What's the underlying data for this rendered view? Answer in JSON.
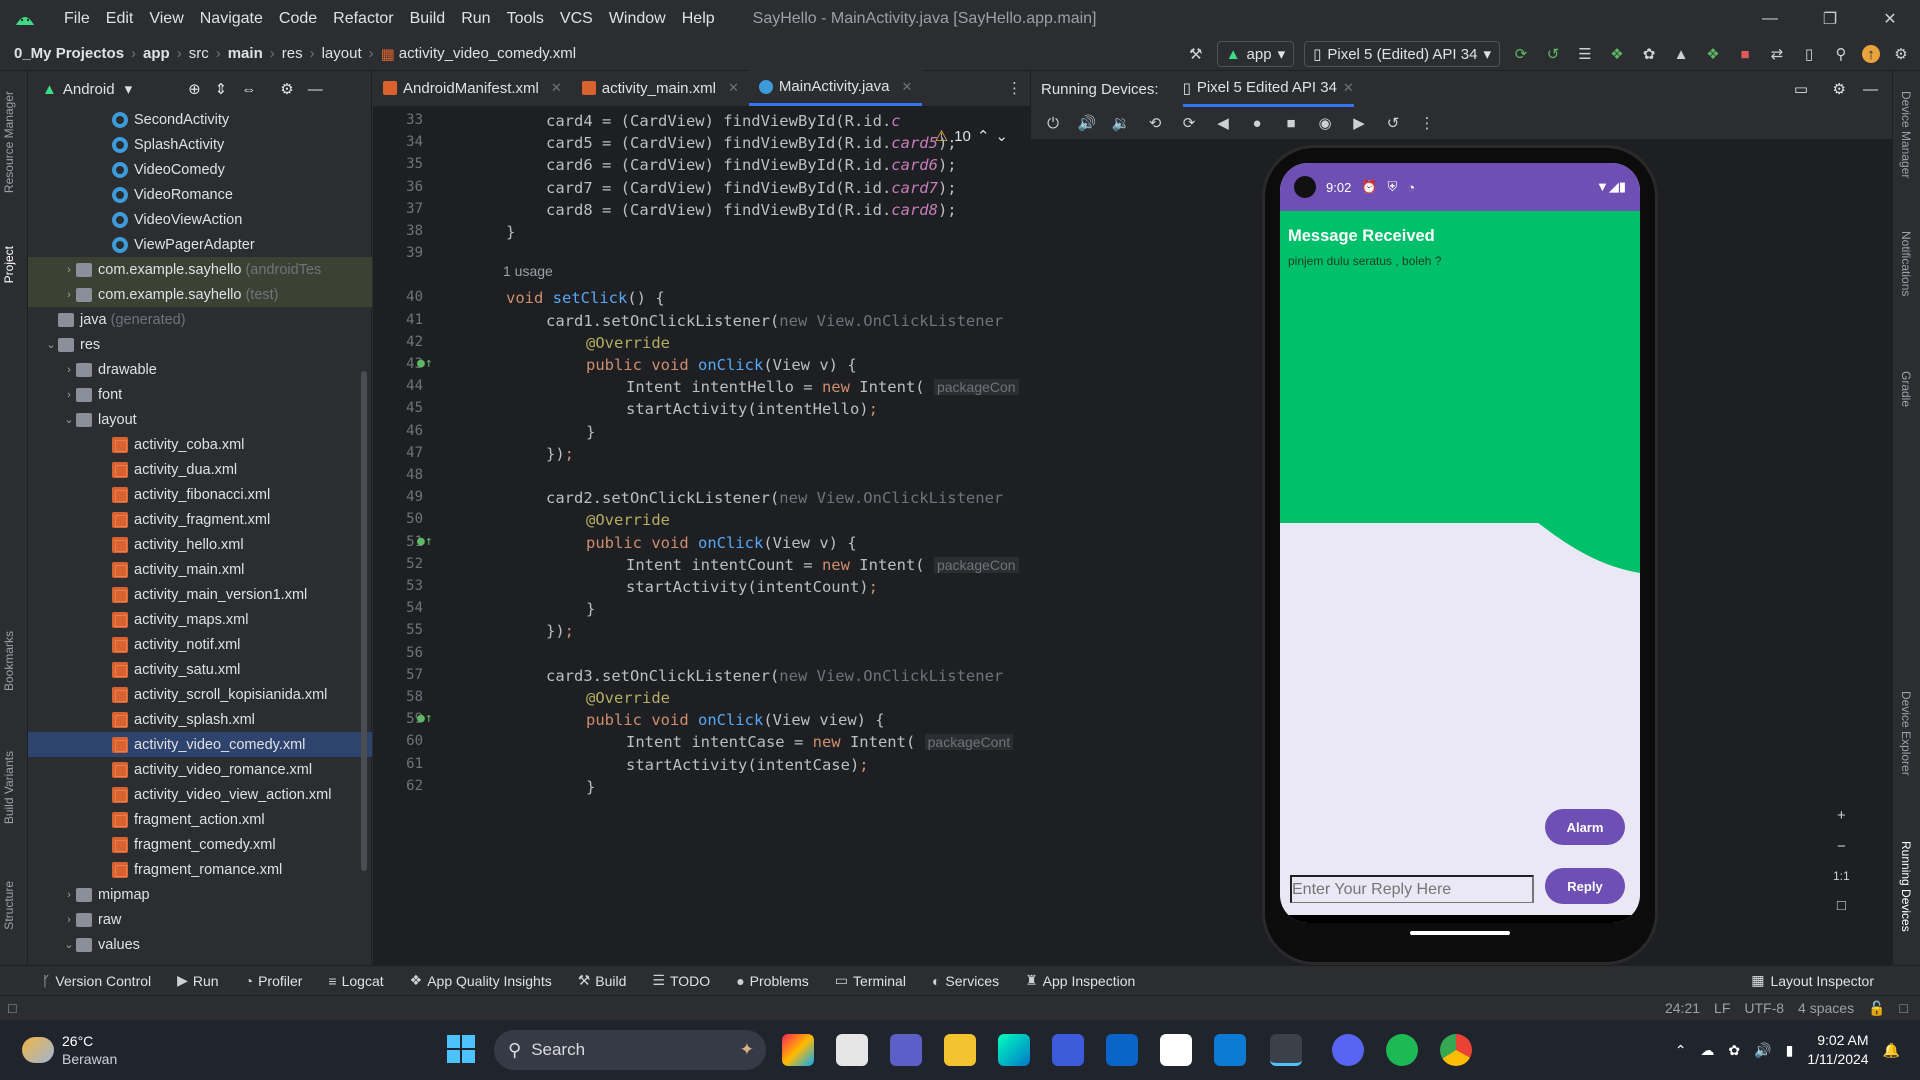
{
  "window": {
    "title": "SayHello - MainActivity.java [SayHello.app.main]",
    "menu": [
      "File",
      "Edit",
      "View",
      "Navigate",
      "Code",
      "Refactor",
      "Build",
      "Run",
      "Tools",
      "VCS",
      "Window",
      "Help"
    ]
  },
  "breadcrumb": [
    "0_My Projectos",
    "app",
    "src",
    "main",
    "res",
    "layout",
    "activity_video_comedy.xml"
  ],
  "toolbar": {
    "run_config": "app",
    "device": "Pixel 5 (Edited) API 34"
  },
  "project_panel": {
    "view_mode": "Android",
    "tree": [
      {
        "label": "SecondActivity",
        "type": "class",
        "indent": 5
      },
      {
        "label": "SplashActivity",
        "type": "class",
        "indent": 5
      },
      {
        "label": "VideoComedy",
        "type": "class",
        "indent": 5
      },
      {
        "label": "VideoRomance",
        "type": "class",
        "indent": 5
      },
      {
        "label": "VideoViewAction",
        "type": "class",
        "indent": 5
      },
      {
        "label": "ViewPagerAdapter",
        "type": "class",
        "indent": 5
      },
      {
        "label": "com.example.sayhello",
        "suffix": "(androidTes",
        "type": "pkg",
        "indent": 3,
        "arrow": "›",
        "bg": "grn"
      },
      {
        "label": "com.example.sayhello",
        "suffix": "(test)",
        "type": "pkg",
        "indent": 3,
        "arrow": "›",
        "bg": "grn"
      },
      {
        "label": "java",
        "suffix": "(generated)",
        "type": "folder",
        "indent": 2
      },
      {
        "label": "res",
        "type": "folder",
        "indent": 2,
        "arrow": "⌄"
      },
      {
        "label": "drawable",
        "type": "folder",
        "indent": 3,
        "arrow": "›"
      },
      {
        "label": "font",
        "type": "folder",
        "indent": 3,
        "arrow": "›"
      },
      {
        "label": "layout",
        "type": "folder",
        "indent": 3,
        "arrow": "⌄"
      },
      {
        "label": "activity_coba.xml",
        "type": "xml",
        "indent": 5
      },
      {
        "label": "activity_dua.xml",
        "type": "xml",
        "indent": 5
      },
      {
        "label": "activity_fibonacci.xml",
        "type": "xml",
        "indent": 5
      },
      {
        "label": "activity_fragment.xml",
        "type": "xml",
        "indent": 5
      },
      {
        "label": "activity_hello.xml",
        "type": "xml",
        "indent": 5
      },
      {
        "label": "activity_main.xml",
        "type": "xml",
        "indent": 5
      },
      {
        "label": "activity_main_version1.xml",
        "type": "xml",
        "indent": 5
      },
      {
        "label": "activity_maps.xml",
        "type": "xml",
        "indent": 5
      },
      {
        "label": "activity_notif.xml",
        "type": "xml",
        "indent": 5
      },
      {
        "label": "activity_satu.xml",
        "type": "xml",
        "indent": 5
      },
      {
        "label": "activity_scroll_kopisianida.xml",
        "type": "xml",
        "indent": 5
      },
      {
        "label": "activity_splash.xml",
        "type": "xml",
        "indent": 5
      },
      {
        "label": "activity_video_comedy.xml",
        "type": "xml",
        "indent": 5,
        "bg": "hl"
      },
      {
        "label": "activity_video_romance.xml",
        "type": "xml",
        "indent": 5
      },
      {
        "label": "activity_video_view_action.xml",
        "type": "xml",
        "indent": 5
      },
      {
        "label": "fragment_action.xml",
        "type": "xml",
        "indent": 5
      },
      {
        "label": "fragment_comedy.xml",
        "type": "xml",
        "indent": 5
      },
      {
        "label": "fragment_romance.xml",
        "type": "xml",
        "indent": 5
      },
      {
        "label": "mipmap",
        "type": "folder",
        "indent": 3,
        "arrow": "›"
      },
      {
        "label": "raw",
        "type": "folder",
        "indent": 3,
        "arrow": "›"
      },
      {
        "label": "values",
        "type": "folder",
        "indent": 3,
        "arrow": "⌄"
      }
    ]
  },
  "editor": {
    "tabs": [
      {
        "label": "AndroidManifest.xml",
        "icon": "manifest-icon"
      },
      {
        "label": "activity_main.xml",
        "icon": "xml-icon"
      },
      {
        "label": "MainActivity.java",
        "icon": "class-icon",
        "active": true
      }
    ],
    "warnings": "10",
    "usage_hint": "1 usage",
    "lines": [
      {
        "n": "33",
        "html": "card4 = (CardView) findViewById(R.id.<i class='it'>c</i>"
      },
      {
        "n": "34",
        "html": "card5 = (CardView) findViewById(R.id.<i class='it'>card5</i>);"
      },
      {
        "n": "35",
        "html": "card6 = (CardView) findViewById(R.id.<i class='it'>card6</i>);"
      },
      {
        "n": "36",
        "html": "card7 = (CardView) findViewById(R.id.<i class='it'>card7</i>);"
      },
      {
        "n": "37",
        "html": "card8 = (CardView) findViewById(R.id.<i class='it'>card8</i>);"
      },
      {
        "n": "38",
        "html": "}"
      },
      {
        "n": "39",
        "html": ""
      },
      {
        "n": "40",
        "html": "<span class='kw'>void</span> <span class='fn'>setClick</span>() {"
      },
      {
        "n": "41",
        "html": "card1.setOnClickListener(<span class='kw gr'>new</span><span class='gr'> View.OnClickListener</span>"
      },
      {
        "n": "42",
        "html": "<span class='an'>@Override</span>"
      },
      {
        "n": "43",
        "html": "<span class='kw'>public void</span> <span class='fn'>onClick</span>(View v) {"
      },
      {
        "n": "44",
        "html": "Intent intentHello = <span class='kw'>new</span> Intent( <span class='pm'>packageCon</span>"
      },
      {
        "n": "45",
        "html": "startActivity(intentHello)<span class='kw'>;</span>"
      },
      {
        "n": "46",
        "html": "}"
      },
      {
        "n": "47",
        "html": "})<span class='kw'>;</span>"
      },
      {
        "n": "48",
        "html": ""
      },
      {
        "n": "49",
        "html": "card2.setOnClickListener(<span class='kw gr'>new</span><span class='gr'> View.OnClickListener</span>"
      },
      {
        "n": "50",
        "html": "<span class='an'>@Override</span>"
      },
      {
        "n": "51",
        "html": "<span class='kw'>public void</span> <span class='fn'>onClick</span>(View v) {"
      },
      {
        "n": "52",
        "html": "Intent intentCount = <span class='kw'>new</span> Intent( <span class='pm'>packageCon</span>"
      },
      {
        "n": "53",
        "html": "startActivity(intentCount)<span class='kw'>;</span>"
      },
      {
        "n": "54",
        "html": "}"
      },
      {
        "n": "55",
        "html": "})<span class='kw'>;</span>"
      },
      {
        "n": "56",
        "html": ""
      },
      {
        "n": "57",
        "html": "card3.setOnClickListener(<span class='kw gr'>new</span><span class='gr'> View.OnClickListener</span>"
      },
      {
        "n": "58",
        "html": "<span class='an'>@Override</span>"
      },
      {
        "n": "59",
        "html": "<span class='kw'>public void</span> <span class='fn'>onClick</span>(View view) {"
      },
      {
        "n": "60",
        "html": "Intent intentCase = <span class='kw'>new</span> Intent( <span class='pm'>packageCont</span>"
      },
      {
        "n": "61",
        "html": "startActivity(intentCase)<span class='kw'>;</span>"
      },
      {
        "n": "62",
        "html": "}"
      }
    ]
  },
  "devices": {
    "header": "Running Devices:",
    "tab": "Pixel 5 Edited API 34",
    "phone": {
      "time": "9:02",
      "notif_title": "Message Received",
      "notif_body": "pinjem dulu seratus , boleh ?",
      "alarm_label": "Alarm",
      "reply_label": "Reply",
      "reply_placeholder": "Enter Your Reply Here"
    },
    "zoom_label": "1:1"
  },
  "left_tabs": [
    "Resource Manager",
    "Project",
    "Bookmarks",
    "Build Variants",
    "Structure"
  ],
  "right_tabs": [
    "Device Manager",
    "Notifications",
    "Gradle",
    "Device Explorer",
    "Running Devices"
  ],
  "bottom_tools": [
    "Version Control",
    "Run",
    "Profiler",
    "Logcat",
    "App Quality Insights",
    "Build",
    "TODO",
    "Problems",
    "Terminal",
    "Services",
    "App Inspection"
  ],
  "layout_inspector": "Layout Inspector",
  "status": {
    "position": "24:21",
    "line_sep": "LF",
    "encoding": "UTF-8",
    "indent": "4 spaces"
  },
  "taskbar": {
    "temp": "26°C",
    "weather": "Berawan",
    "search": "Search",
    "time": "9:02 AM",
    "date": "1/11/2024"
  }
}
